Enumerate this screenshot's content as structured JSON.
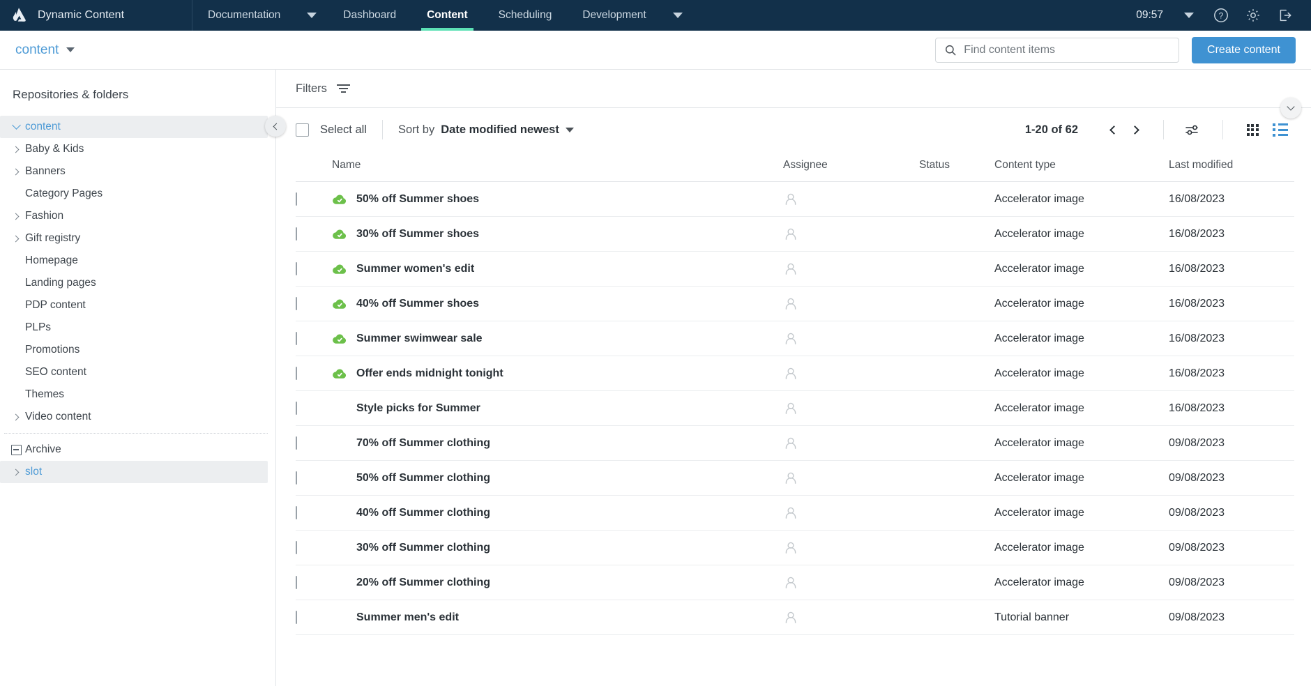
{
  "topnav": {
    "logo_icon": "amplience-logo-icon",
    "brand": "Dynamic Content",
    "tabs": [
      {
        "label": "Documentation",
        "active": false,
        "has_caret": true
      },
      {
        "label": "Dashboard",
        "active": false,
        "has_caret": false
      },
      {
        "label": "Content",
        "active": true,
        "has_caret": false
      },
      {
        "label": "Scheduling",
        "active": false,
        "has_caret": false
      },
      {
        "label": "Development",
        "active": false,
        "has_caret": true
      }
    ],
    "clock": "09:57",
    "account_caret_icon": "chevron-down-icon",
    "help_icon": "help-circle-icon",
    "settings_icon": "gear-icon",
    "logout_icon": "logout-icon",
    "accent": "#5ce0b5",
    "background": "#12304a"
  },
  "subheader": {
    "repository_label": "content",
    "repository_caret_icon": "caret-down-icon",
    "search": {
      "placeholder": "Find content items",
      "value": "",
      "icon": "search-icon"
    },
    "create_button": "Create content",
    "create_button_color": "#3f92d2"
  },
  "sidebar": {
    "title": "Repositories & folders",
    "collapse_icon": "chevron-left-icon",
    "tree": [
      {
        "label": "content",
        "icon": "chevron-down-icon",
        "depth": 0,
        "selected": true
      },
      {
        "label": "Baby & Kids",
        "icon": "chevron-right-icon",
        "depth": 1,
        "selected": false
      },
      {
        "label": "Banners",
        "icon": "chevron-right-icon",
        "depth": 1,
        "selected": false
      },
      {
        "label": "Category Pages",
        "icon": "none",
        "depth": 1,
        "selected": false
      },
      {
        "label": "Fashion",
        "icon": "chevron-right-icon",
        "depth": 1,
        "selected": false
      },
      {
        "label": "Gift registry",
        "icon": "chevron-right-icon",
        "depth": 1,
        "selected": false
      },
      {
        "label": "Homepage",
        "icon": "none",
        "depth": 1,
        "selected": false
      },
      {
        "label": "Landing pages",
        "icon": "none",
        "depth": 1,
        "selected": false
      },
      {
        "label": "PDP content",
        "icon": "none",
        "depth": 1,
        "selected": false
      },
      {
        "label": "PLPs",
        "icon": "none",
        "depth": 1,
        "selected": false
      },
      {
        "label": "Promotions",
        "icon": "none",
        "depth": 1,
        "selected": false
      },
      {
        "label": "SEO content",
        "icon": "none",
        "depth": 1,
        "selected": false
      },
      {
        "label": "Themes",
        "icon": "none",
        "depth": 1,
        "selected": false
      },
      {
        "label": "Video content",
        "icon": "chevron-right-icon",
        "depth": 1,
        "selected": false
      },
      {
        "label": "__separator__",
        "icon": "none",
        "depth": 0,
        "selected": false
      },
      {
        "label": "Archive",
        "icon": "box-minus-icon",
        "depth": 0,
        "selected": false
      },
      {
        "label": "slot",
        "icon": "chevron-right-icon",
        "depth": 0,
        "selected": true
      }
    ]
  },
  "filterbar": {
    "label": "Filters",
    "filter_icon": "filter-icon",
    "expand_icon": "chevron-down-icon"
  },
  "toolbar": {
    "select_all": "Select all",
    "sort_by_label": "Sort by",
    "sort_value": "Date modified newest",
    "sort_caret_icon": "caret-down-icon",
    "page_count": "1-20 of 62",
    "prev_icon": "chevron-left-icon",
    "next_icon": "chevron-right-icon",
    "settings_icon": "sliders-icon",
    "grid_view_icon": "grid-view-icon",
    "list_view_icon": "list-view-icon",
    "active_view": "list"
  },
  "table": {
    "columns": [
      "Name",
      "Assignee",
      "Status",
      "Content type",
      "Last modified"
    ],
    "rows": [
      {
        "name": "50% off Summer shoes",
        "published": true,
        "assignee_icon": "user-avatar-icon",
        "status": "",
        "content_type": "Accelerator image",
        "last_modified": "16/08/2023"
      },
      {
        "name": "30% off Summer shoes",
        "published": true,
        "assignee_icon": "user-avatar-icon",
        "status": "",
        "content_type": "Accelerator image",
        "last_modified": "16/08/2023"
      },
      {
        "name": "Summer women's edit",
        "published": true,
        "assignee_icon": "user-avatar-icon",
        "status": "",
        "content_type": "Accelerator image",
        "last_modified": "16/08/2023"
      },
      {
        "name": "40% off Summer shoes",
        "published": true,
        "assignee_icon": "user-avatar-icon",
        "status": "",
        "content_type": "Accelerator image",
        "last_modified": "16/08/2023"
      },
      {
        "name": "Summer swimwear sale",
        "published": true,
        "assignee_icon": "user-avatar-icon",
        "status": "",
        "content_type": "Accelerator image",
        "last_modified": "16/08/2023"
      },
      {
        "name": "Offer ends midnight tonight",
        "published": true,
        "assignee_icon": "user-avatar-icon",
        "status": "",
        "content_type": "Accelerator image",
        "last_modified": "16/08/2023"
      },
      {
        "name": "Style picks for Summer",
        "published": false,
        "assignee_icon": "user-avatar-icon",
        "status": "",
        "content_type": "Accelerator image",
        "last_modified": "16/08/2023"
      },
      {
        "name": "70% off Summer clothing",
        "published": false,
        "assignee_icon": "user-avatar-icon",
        "status": "",
        "content_type": "Accelerator image",
        "last_modified": "09/08/2023"
      },
      {
        "name": "50% off Summer clothing",
        "published": false,
        "assignee_icon": "user-avatar-icon",
        "status": "",
        "content_type": "Accelerator image",
        "last_modified": "09/08/2023"
      },
      {
        "name": "40% off Summer clothing",
        "published": false,
        "assignee_icon": "user-avatar-icon",
        "status": "",
        "content_type": "Accelerator image",
        "last_modified": "09/08/2023"
      },
      {
        "name": "30% off Summer clothing",
        "published": false,
        "assignee_icon": "user-avatar-icon",
        "status": "",
        "content_type": "Accelerator image",
        "last_modified": "09/08/2023"
      },
      {
        "name": "20% off Summer clothing",
        "published": false,
        "assignee_icon": "user-avatar-icon",
        "status": "",
        "content_type": "Accelerator image",
        "last_modified": "09/08/2023"
      },
      {
        "name": "Summer men's edit",
        "published": false,
        "assignee_icon": "user-avatar-icon",
        "status": "",
        "content_type": "Tutorial banner",
        "last_modified": "09/08/2023"
      }
    ],
    "published_icon": "cloud-check-icon",
    "published_color": "#6cc04a"
  }
}
